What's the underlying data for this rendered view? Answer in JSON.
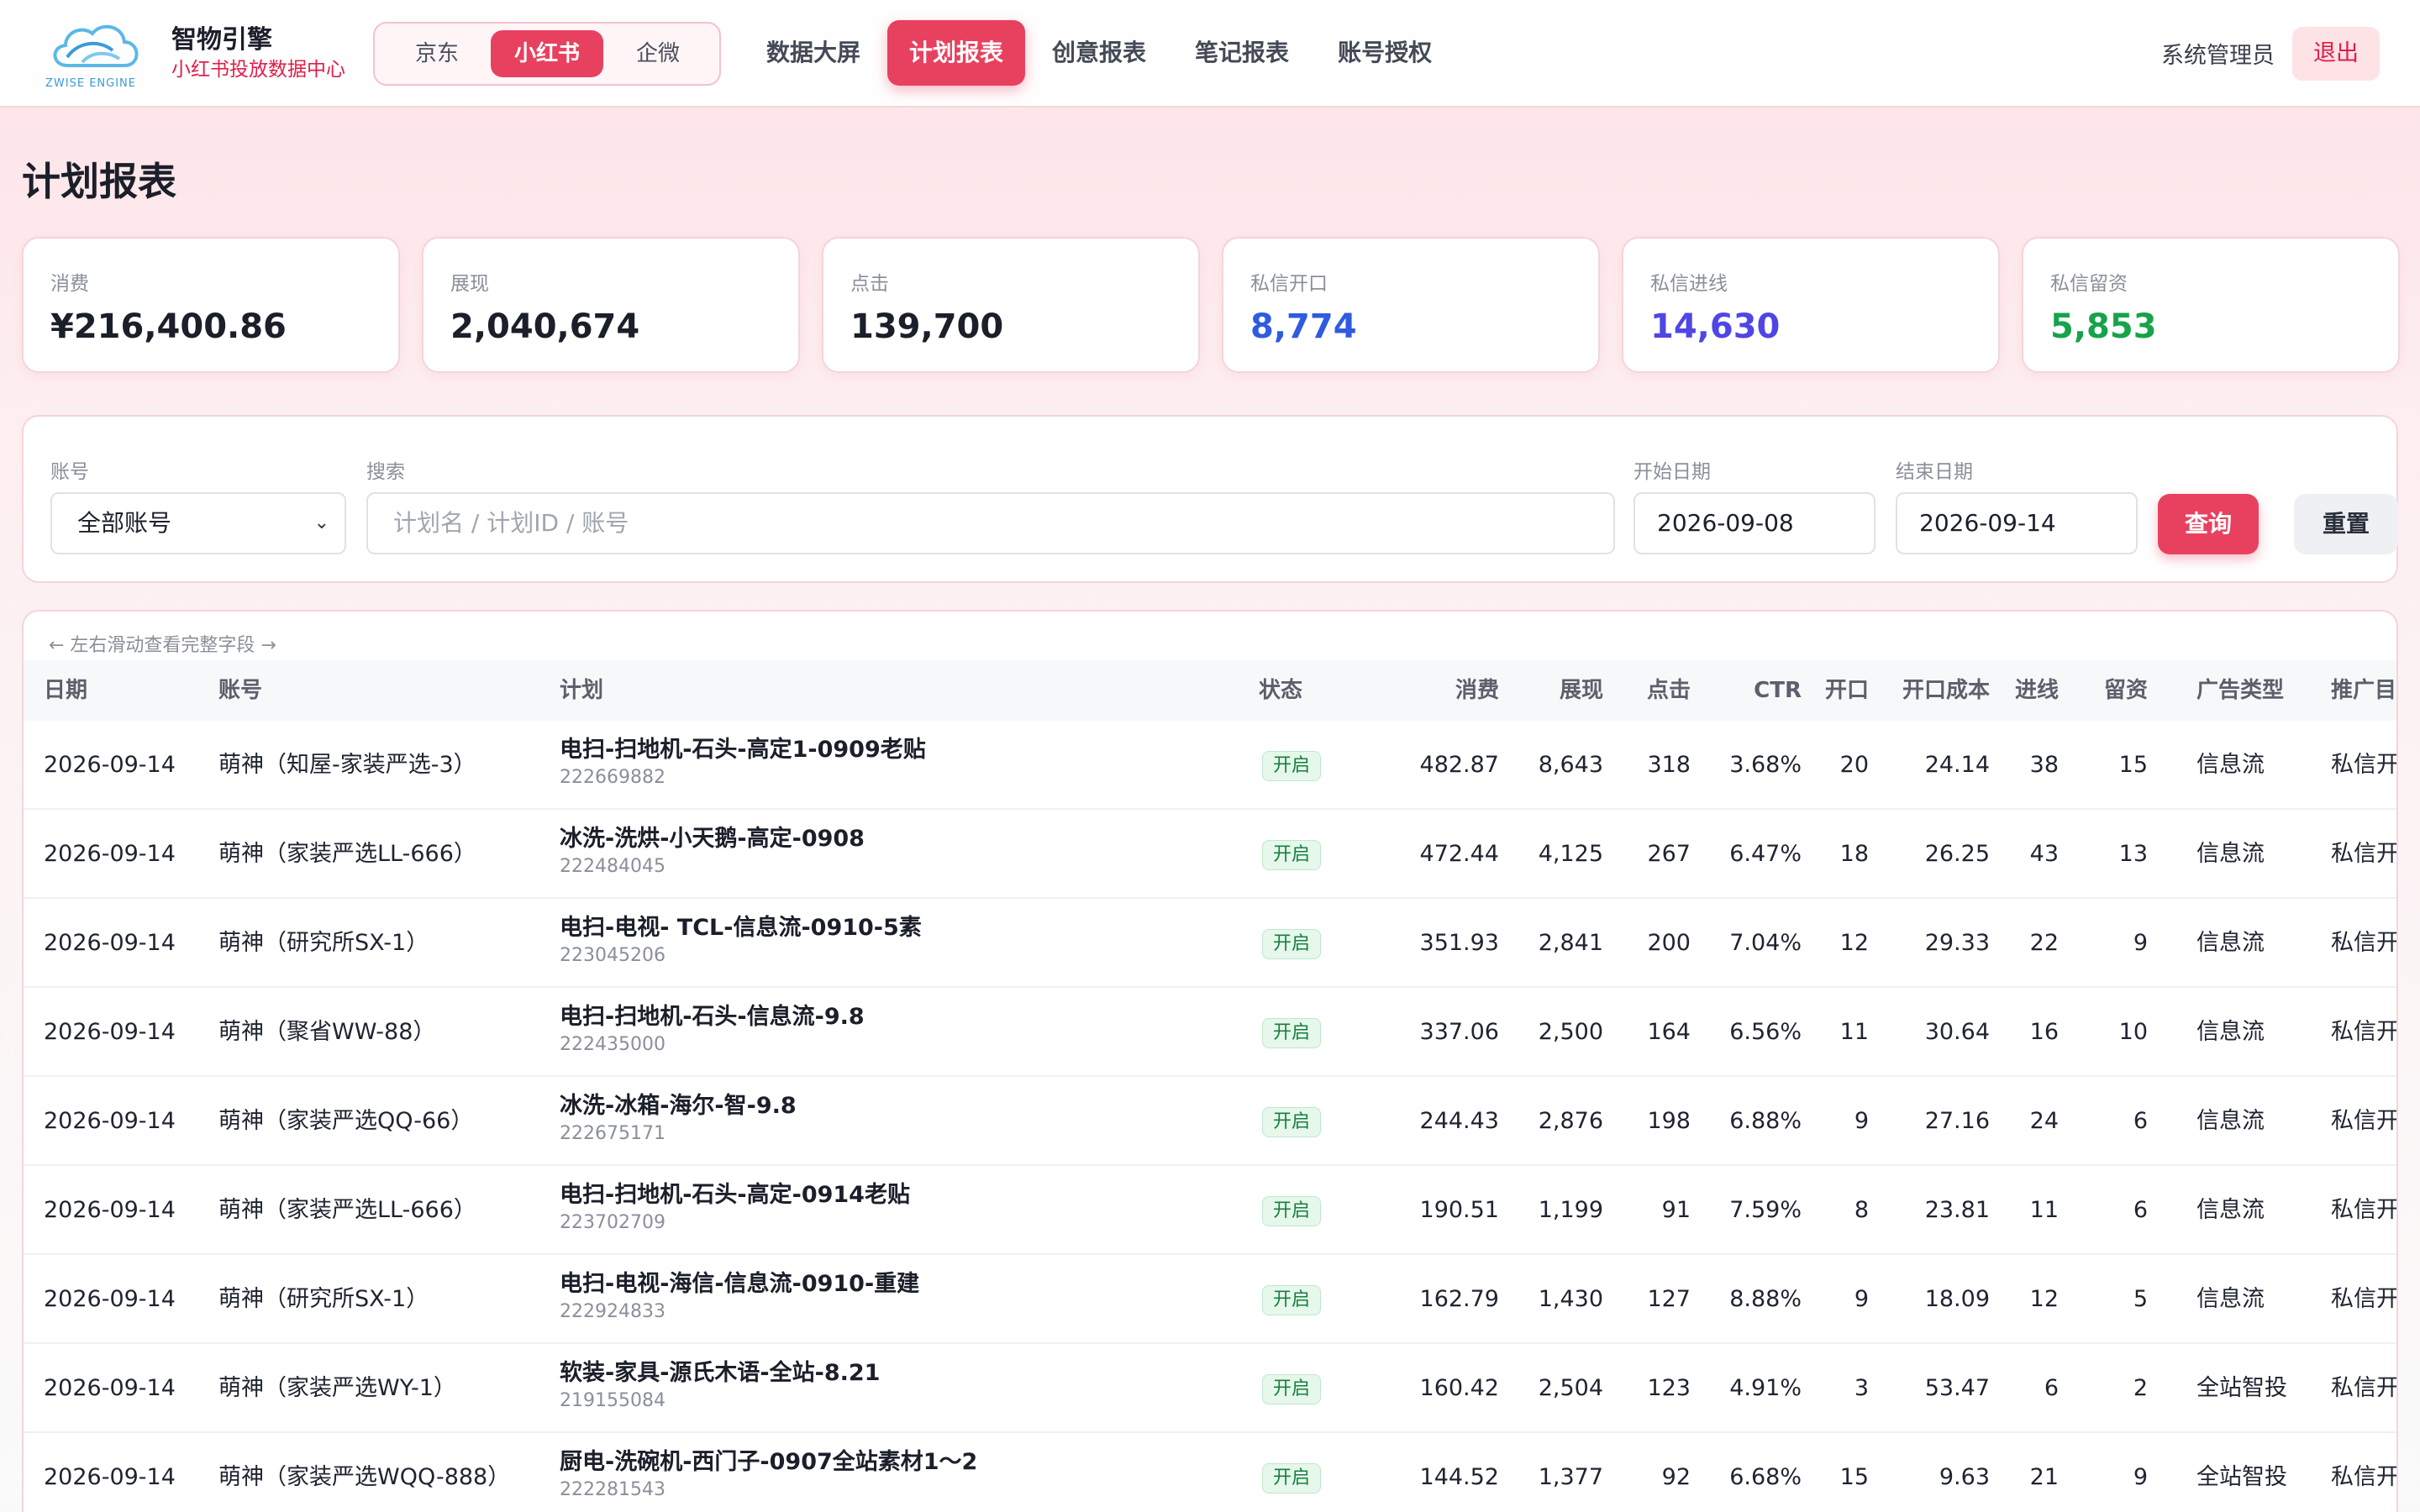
{
  "brand": {
    "logo_text": "ZWISE ENGINE",
    "name": "智物引擎",
    "subtitle": "小红书投放数据中心"
  },
  "platforms": [
    {
      "label": "京东",
      "active": false
    },
    {
      "label": "小红书",
      "active": true
    },
    {
      "label": "企微",
      "active": false
    }
  ],
  "nav": [
    {
      "label": "数据大屏",
      "active": false
    },
    {
      "label": "计划报表",
      "active": true
    },
    {
      "label": "创意报表",
      "active": false
    },
    {
      "label": "笔记报表",
      "active": false
    },
    {
      "label": "账号授权",
      "active": false
    }
  ],
  "user": {
    "name": "系统管理员",
    "logout": "退出"
  },
  "page_title": "计划报表",
  "stats": [
    {
      "label": "消费",
      "value": "¥216,400.86",
      "color": "#1b1f2a"
    },
    {
      "label": "展现",
      "value": "2,040,674",
      "color": "#1b1f2a"
    },
    {
      "label": "点击",
      "value": "139,700",
      "color": "#1b1f2a"
    },
    {
      "label": "私信开口",
      "value": "8,774",
      "color": "#2f5be0"
    },
    {
      "label": "私信进线",
      "value": "14,630",
      "color": "#4f46e5"
    },
    {
      "label": "私信留资",
      "value": "5,853",
      "color": "#16a34a"
    }
  ],
  "filters": {
    "account_label": "账号",
    "account_value": "全部账号",
    "search_label": "搜索",
    "search_placeholder": "计划名 / 计划ID / 账号",
    "start_label": "开始日期",
    "start_value": "2026-09-08",
    "end_label": "结束日期",
    "end_value": "2026-09-14",
    "query": "查询",
    "reset": "重置"
  },
  "table": {
    "hint": "← 左右滑动查看完整字段 →",
    "columns": [
      "日期",
      "账号",
      "计划",
      "状态",
      "消费",
      "展现",
      "点击",
      "CTR",
      "开口",
      "开口成本",
      "进线",
      "留资",
      "广告类型",
      "推广目"
    ],
    "rows": [
      {
        "date": "2026-09-14",
        "account": "萌神（知屋-家装严选-3）",
        "plan": "电扫-扫地机-石头-高定1-0909老贴",
        "plan_id": "222669882",
        "status": "开启",
        "spend": "482.87",
        "impressions": "8,643",
        "clicks": "318",
        "ctr": "3.68%",
        "opens": "20",
        "open_cost": "24.14",
        "leads_in": "38",
        "leads_kept": "15",
        "ad_type": "信息流",
        "goal": "私信开"
      },
      {
        "date": "2026-09-14",
        "account": "萌神（家装严选LL-666）",
        "plan": "冰洗-洗烘-小天鹅-高定-0908",
        "plan_id": "222484045",
        "status": "开启",
        "spend": "472.44",
        "impressions": "4,125",
        "clicks": "267",
        "ctr": "6.47%",
        "opens": "18",
        "open_cost": "26.25",
        "leads_in": "43",
        "leads_kept": "13",
        "ad_type": "信息流",
        "goal": "私信开"
      },
      {
        "date": "2026-09-14",
        "account": "萌神（研究所SX-1）",
        "plan": "电扫-电视- TCL-信息流-0910-5素",
        "plan_id": "223045206",
        "status": "开启",
        "spend": "351.93",
        "impressions": "2,841",
        "clicks": "200",
        "ctr": "7.04%",
        "opens": "12",
        "open_cost": "29.33",
        "leads_in": "22",
        "leads_kept": "9",
        "ad_type": "信息流",
        "goal": "私信开"
      },
      {
        "date": "2026-09-14",
        "account": "萌神（聚省WW-88）",
        "plan": "电扫-扫地机-石头-信息流-9.8",
        "plan_id": "222435000",
        "status": "开启",
        "spend": "337.06",
        "impressions": "2,500",
        "clicks": "164",
        "ctr": "6.56%",
        "opens": "11",
        "open_cost": "30.64",
        "leads_in": "16",
        "leads_kept": "10",
        "ad_type": "信息流",
        "goal": "私信开"
      },
      {
        "date": "2026-09-14",
        "account": "萌神（家装严选QQ-66）",
        "plan": "冰洗-冰箱-海尔-智-9.8",
        "plan_id": "222675171",
        "status": "开启",
        "spend": "244.43",
        "impressions": "2,876",
        "clicks": "198",
        "ctr": "6.88%",
        "opens": "9",
        "open_cost": "27.16",
        "leads_in": "24",
        "leads_kept": "6",
        "ad_type": "信息流",
        "goal": "私信开"
      },
      {
        "date": "2026-09-14",
        "account": "萌神（家装严选LL-666）",
        "plan": "电扫-扫地机-石头-高定-0914老贴",
        "plan_id": "223702709",
        "status": "开启",
        "spend": "190.51",
        "impressions": "1,199",
        "clicks": "91",
        "ctr": "7.59%",
        "opens": "8",
        "open_cost": "23.81",
        "leads_in": "11",
        "leads_kept": "6",
        "ad_type": "信息流",
        "goal": "私信开"
      },
      {
        "date": "2026-09-14",
        "account": "萌神（研究所SX-1）",
        "plan": "电扫-电视-海信-信息流-0910-重建",
        "plan_id": "222924833",
        "status": "开启",
        "spend": "162.79",
        "impressions": "1,430",
        "clicks": "127",
        "ctr": "8.88%",
        "opens": "9",
        "open_cost": "18.09",
        "leads_in": "12",
        "leads_kept": "5",
        "ad_type": "信息流",
        "goal": "私信开"
      },
      {
        "date": "2026-09-14",
        "account": "萌神（家装严选WY-1）",
        "plan": "软装-家具-源氏木语-全站-8.21",
        "plan_id": "219155084",
        "status": "开启",
        "spend": "160.42",
        "impressions": "2,504",
        "clicks": "123",
        "ctr": "4.91%",
        "opens": "3",
        "open_cost": "53.47",
        "leads_in": "6",
        "leads_kept": "2",
        "ad_type": "全站智投",
        "goal": "私信开"
      },
      {
        "date": "2026-09-14",
        "account": "萌神（家装严选WQQ-888）",
        "plan": "厨电-洗碗机-西门子-0907全站素材1～2",
        "plan_id": "222281543",
        "status": "开启",
        "spend": "144.52",
        "impressions": "1,377",
        "clicks": "92",
        "ctr": "6.68%",
        "opens": "15",
        "open_cost": "9.63",
        "leads_in": "21",
        "leads_kept": "9",
        "ad_type": "全站智投",
        "goal": "私信开"
      }
    ]
  }
}
